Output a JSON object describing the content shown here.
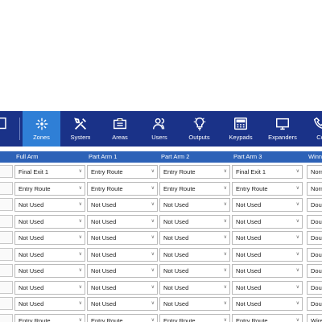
{
  "toolbar": {
    "items": [
      {
        "label": "",
        "icon": "panel-icon"
      },
      {
        "label": "Zones",
        "icon": "zones-icon",
        "active": true
      },
      {
        "label": "System",
        "icon": "tools-icon"
      },
      {
        "label": "Areas",
        "icon": "areas-icon"
      },
      {
        "label": "Users",
        "icon": "users-icon"
      },
      {
        "label": "Outputs",
        "icon": "bulb-icon"
      },
      {
        "label": "Keypads",
        "icon": "keypad-icon"
      },
      {
        "label": "Expanders",
        "icon": "expander-icon"
      },
      {
        "label": "Co",
        "icon": "phone-icon"
      }
    ]
  },
  "grid": {
    "columns": [
      "Full Arm",
      "Part Arm 1",
      "Part Arm 2",
      "Part Arm 3",
      "Winn"
    ],
    "rows": [
      [
        "Final Exit 1",
        "Entry Route",
        "Entry Route",
        "Final Exit 1",
        "Norm"
      ],
      [
        "Entry Route",
        "Entry Route",
        "Entry Route",
        "Entry Route",
        "Norm"
      ],
      [
        "Not Used",
        "Not Used",
        "Not Used",
        "Not Used",
        "Dou"
      ],
      [
        "Not Used",
        "Not Used",
        "Not Used",
        "Not Used",
        "Dou"
      ],
      [
        "Not Used",
        "Not Used",
        "Not Used",
        "Not Used",
        "Dou"
      ],
      [
        "Not Used",
        "Not Used",
        "Not Used",
        "Not Used",
        "Dou"
      ],
      [
        "Not Used",
        "Not Used",
        "Not Used",
        "Not Used",
        "Dou"
      ],
      [
        "Not Used",
        "Not Used",
        "Not Used",
        "Not Used",
        "Dou"
      ],
      [
        "Not Used",
        "Not Used",
        "Not Used",
        "Not Used",
        "Dou"
      ],
      [
        "Entry Route",
        "Entry Route",
        "Entry Route",
        "Entry Route",
        "Wire"
      ]
    ]
  },
  "colors": {
    "toolbar": "#1a3288",
    "active_tab": "#2f7fd6",
    "header": "#2d62b7"
  }
}
